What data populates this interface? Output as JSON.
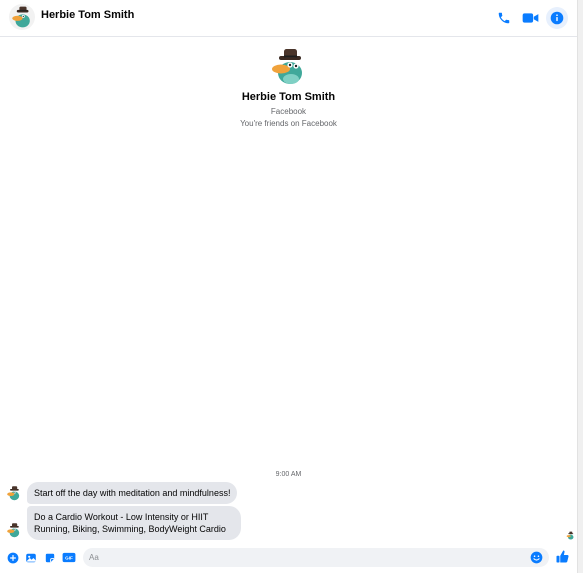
{
  "header": {
    "contact_name": "Herbie Tom Smith",
    "actions": [
      "phone-icon",
      "video-icon",
      "info-icon"
    ]
  },
  "profile": {
    "name": "Herbie Tom Smith",
    "platform": "Facebook",
    "relationship": "You're friends on Facebook"
  },
  "conversation": {
    "timestamp": "9:00 AM",
    "messages": [
      {
        "lines": [
          "Start off the day with meditation and mindfulness!"
        ]
      },
      {
        "lines": [
          "Do a Cardio Workout - Low Intensity or HIIT",
          "Running, Biking, Swimming, BodyWeight Cardio"
        ]
      }
    ]
  },
  "composer": {
    "placeholder": "Aa",
    "tools": [
      "plus-icon",
      "image-icon",
      "sticker-icon",
      "gif-icon"
    ],
    "gif_label": "GIF"
  },
  "colors": {
    "accent": "#0a7cff",
    "bubble": "#e4e6eb",
    "muted_text": "#65676b"
  }
}
